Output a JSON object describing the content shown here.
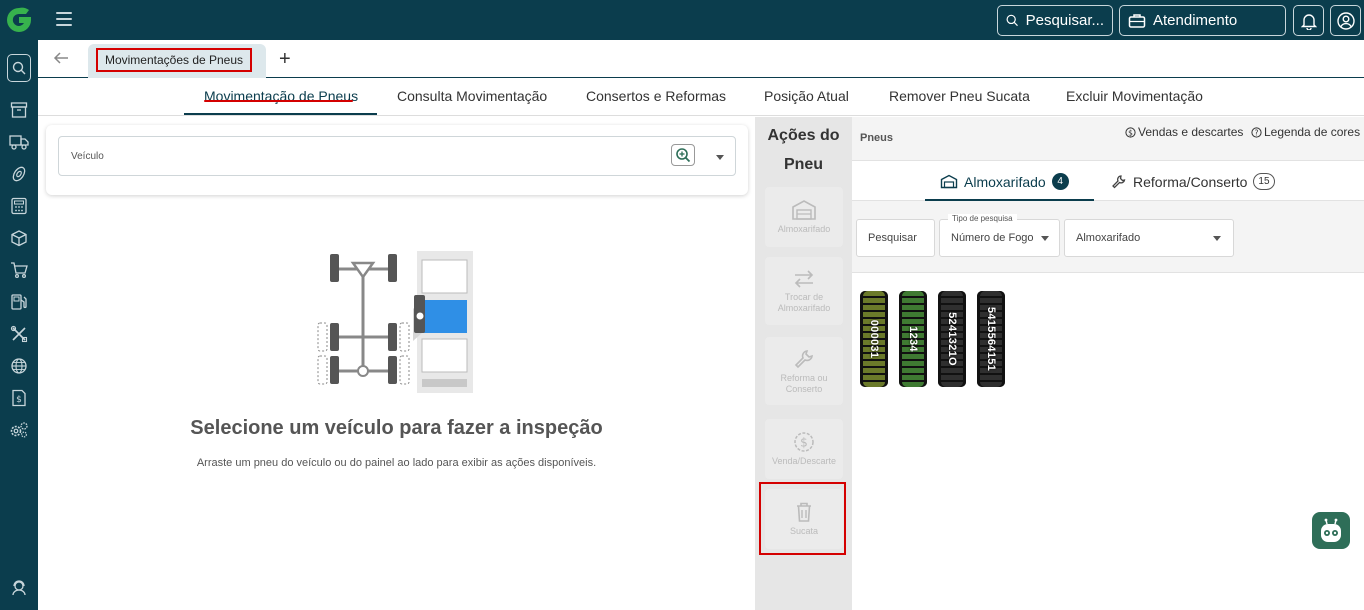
{
  "topbar": {
    "search_label": "Pesquisar...",
    "attend_label": "Atendimento"
  },
  "tabs": {
    "open_tab": "Movimentações de Pneus",
    "add_label": "+"
  },
  "subnav": [
    "Movimentação de Pneus",
    "Consulta Movimentação",
    "Consertos e Reformas",
    "Posição Atual",
    "Remover Pneu Sucata",
    "Excluir Movimentação"
  ],
  "vehicle": {
    "label": "Veículo"
  },
  "empty_state": {
    "title": "Selecione um veículo para fazer a inspeção",
    "subtitle": "Arraste um pneu do veículo ou do painel ao lado para exibir as ações disponíveis."
  },
  "actions": {
    "title": "Ações do Pneu",
    "buttons": [
      "Almoxarifado",
      "Trocar de Almoxarifado",
      "Reforma ou Conserto",
      "Venda/Descarte",
      "Sucata"
    ]
  },
  "pneus": {
    "title": "Pneus",
    "link_sales": "Vendas e descartes",
    "link_legend": "Legenda de cores",
    "tab_almox": "Almoxarifado",
    "tab_almox_count": "4",
    "tab_reforma": "Reforma/Conserto",
    "tab_reforma_count": "15",
    "filter_search_placeholder": "Pesquisar",
    "filter_type_label": "Tipo de pesquisa",
    "filter_type_value": "Número de Fogo",
    "filter_almox_placeholder": "Almoxarifado",
    "tires": [
      "000031",
      "1234",
      "5241321O",
      "5415564151"
    ],
    "tire_colors": [
      "#6b7a2a",
      "#3f7a32",
      "#2f2f2f",
      "#2f2f2f"
    ]
  },
  "colors": {
    "brand_dark": "#0b3d4d",
    "highlight_red": "#d40000",
    "logo_green": "#37b24d"
  }
}
